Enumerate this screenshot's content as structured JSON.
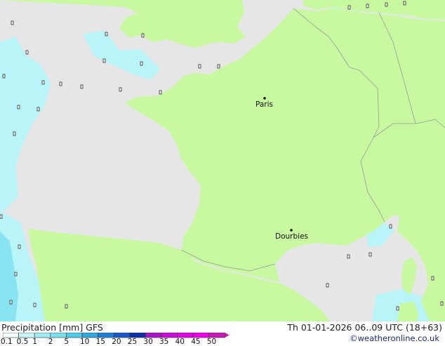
{
  "legend": {
    "title": "Precipitation [mm]  GFS",
    "ticks": [
      "0.1",
      "0.5",
      "1",
      "2",
      "5",
      "10",
      "15",
      "20",
      "25",
      "30",
      "35",
      "40",
      "45",
      "50"
    ],
    "colors": [
      "#f4fefe",
      "#c8f4f8",
      "#a0ecf4",
      "#78e0ee",
      "#50cde8",
      "#30a8e0",
      "#2080d8",
      "#1858c8",
      "#1030a8",
      "#a818c8",
      "#c810d8",
      "#e008e0",
      "#f000e8",
      "#c818b8"
    ]
  },
  "run_time": "Th 01-01-2026 06..09 UTC (18+63)",
  "credit": "©weatheronline.co.uk",
  "cities": [
    {
      "name": "Paris"
    },
    {
      "name": "Dourbies"
    }
  ],
  "map_colors": {
    "land": "#c8f8a0",
    "sea": "#e6e6e6",
    "precip_light": "#b8f4f8",
    "precip_mid": "#88e4f0",
    "border": "#999999"
  }
}
